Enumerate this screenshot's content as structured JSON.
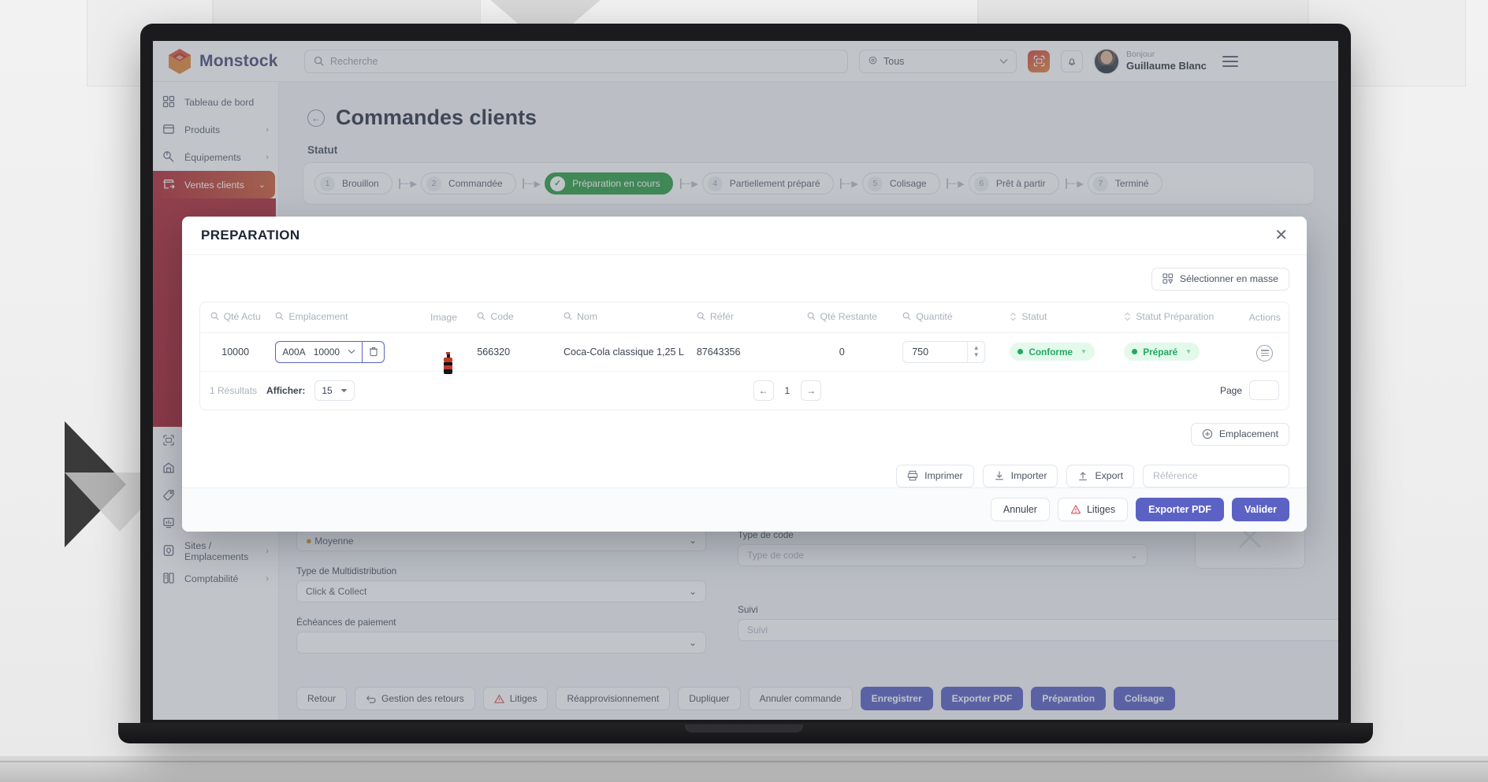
{
  "topbar": {
    "brand": "Monstock",
    "search_placeholder": "Recherche",
    "location_value": "Tous",
    "greeting": "Bonjour",
    "user_name": "Guillaume Blanc"
  },
  "sidebar": {
    "items": [
      {
        "label": "Tableau de bord",
        "icon": "dashboard-icon",
        "chevron": "",
        "active": false
      },
      {
        "label": "Produits",
        "icon": "box-icon",
        "chevron": "›",
        "active": false
      },
      {
        "label": "Équipements",
        "icon": "wrench-icon",
        "chevron": "›",
        "active": false
      },
      {
        "label": "Ventes clients",
        "icon": "store-out-icon",
        "chevron": "⌄",
        "active": true
      },
      {
        "label": "Scan direct",
        "icon": "scan-icon",
        "chevron": "",
        "active": false
      },
      {
        "label": "Stocks",
        "icon": "warehouse-icon",
        "chevron": "›",
        "active": false
      },
      {
        "label": "Impression",
        "icon": "tag-icon",
        "chevron": "›",
        "active": false
      },
      {
        "label": "Rapport",
        "icon": "report-icon",
        "chevron": "›",
        "active": false
      },
      {
        "label": "Sites / Emplacements",
        "icon": "pin-site-icon",
        "chevron": "›",
        "active": false
      },
      {
        "label": "Comptabilité",
        "icon": "ledger-icon",
        "chevron": "›",
        "active": false
      }
    ]
  },
  "page": {
    "title": "Commandes clients",
    "status_label": "Statut",
    "steps": [
      {
        "num": "1",
        "label": "Brouillon",
        "done": false
      },
      {
        "num": "2",
        "label": "Commandée",
        "done": false
      },
      {
        "num": "✓",
        "label": "Préparation en cours",
        "done": true
      },
      {
        "num": "4",
        "label": "Partiellement préparé",
        "done": false
      },
      {
        "num": "5",
        "label": "Colisage",
        "done": false
      },
      {
        "num": "6",
        "label": "Prêt à partir",
        "done": false
      },
      {
        "num": "7",
        "label": "Terminé",
        "done": false
      }
    ]
  },
  "background_form": {
    "priority_value": "Moyenne",
    "multidistribution_label": "Type de Multidistribution",
    "multidistribution_value": "Click & Collect",
    "echeances_label": "Échéances de paiement",
    "echeances_value": "",
    "type_code_label": "Type de code",
    "type_code_placeholder": "Type de code",
    "suivi_label": "Suivi",
    "suivi_placeholder": "Suivi"
  },
  "background_footer": {
    "buttons": [
      {
        "label": "Retour",
        "primary": false,
        "icon": ""
      },
      {
        "label": "Gestion des retours",
        "primary": false,
        "icon": "return-icon"
      },
      {
        "label": "Litiges",
        "primary": false,
        "icon": "dispute-icon"
      },
      {
        "label": "Réapprovisionnement",
        "primary": false,
        "icon": ""
      },
      {
        "label": "Dupliquer",
        "primary": false,
        "icon": ""
      },
      {
        "label": "Annuler commande",
        "primary": false,
        "icon": ""
      },
      {
        "label": "Enregistrer",
        "primary": true,
        "icon": ""
      },
      {
        "label": "Exporter PDF",
        "primary": true,
        "icon": ""
      },
      {
        "label": "Préparation",
        "primary": true,
        "icon": ""
      },
      {
        "label": "Colisage",
        "primary": true,
        "icon": ""
      }
    ]
  },
  "modal": {
    "title": "PREPARATION",
    "close_icon": "✕",
    "bulk_select_label": "Sélectionner en masse",
    "table": {
      "columns": [
        {
          "label": "Qté Actu",
          "search": true,
          "sort": false
        },
        {
          "label": "Emplacement",
          "search": true,
          "sort": false
        },
        {
          "label": "Image",
          "search": false,
          "sort": false
        },
        {
          "label": "Code",
          "search": true,
          "sort": false
        },
        {
          "label": "Nom",
          "search": true,
          "sort": false
        },
        {
          "label": "Référ",
          "search": true,
          "sort": false
        },
        {
          "label": "Qté Restante",
          "search": true,
          "sort": false
        },
        {
          "label": "Quantité",
          "search": true,
          "sort": false
        },
        {
          "label": "Statut",
          "search": false,
          "sort": true
        },
        {
          "label": "Statut Préparation",
          "search": false,
          "sort": true
        },
        {
          "label": "Actions",
          "search": false,
          "sort": false
        }
      ],
      "rows": [
        {
          "qte_actuelle": "10000",
          "emplacement_code": "A00A",
          "emplacement_qty": "10000",
          "image": "coca-bottle-icon",
          "code": "566320",
          "nom": "Coca-Cola classique 1,25 L",
          "reference": "87643356",
          "qte_restante": "0",
          "quantite": "750",
          "statut": "Conforme",
          "statut_preparation": "Préparé"
        }
      ]
    },
    "pager": {
      "results": "1 Résultats",
      "afficher_label": "Afficher:",
      "page_size": "15",
      "prev_icon": "←",
      "current": "1",
      "next_icon": "→",
      "page_label": "Page",
      "page_value": ""
    },
    "emplacement_label": "Emplacement",
    "io_buttons": [
      {
        "label": "Imprimer",
        "icon": "printer-icon"
      },
      {
        "label": "Importer",
        "icon": "import-icon"
      },
      {
        "label": "Export",
        "icon": "export-icon"
      }
    ],
    "reference_placeholder": "Référence",
    "footer_buttons": [
      {
        "label": "Annuler",
        "primary": false,
        "icon": ""
      },
      {
        "label": "Litiges",
        "primary": false,
        "icon": "dispute-icon"
      },
      {
        "label": "Exporter PDF",
        "primary": true,
        "icon": ""
      },
      {
        "label": "Valider",
        "primary": true,
        "icon": ""
      }
    ]
  },
  "colors": {
    "brand_red": "#b02a37",
    "brand_orange": "#cf5f3a",
    "primary": "#5b62c4",
    "success": "#22a95f",
    "step_done": "#2f9e44"
  }
}
